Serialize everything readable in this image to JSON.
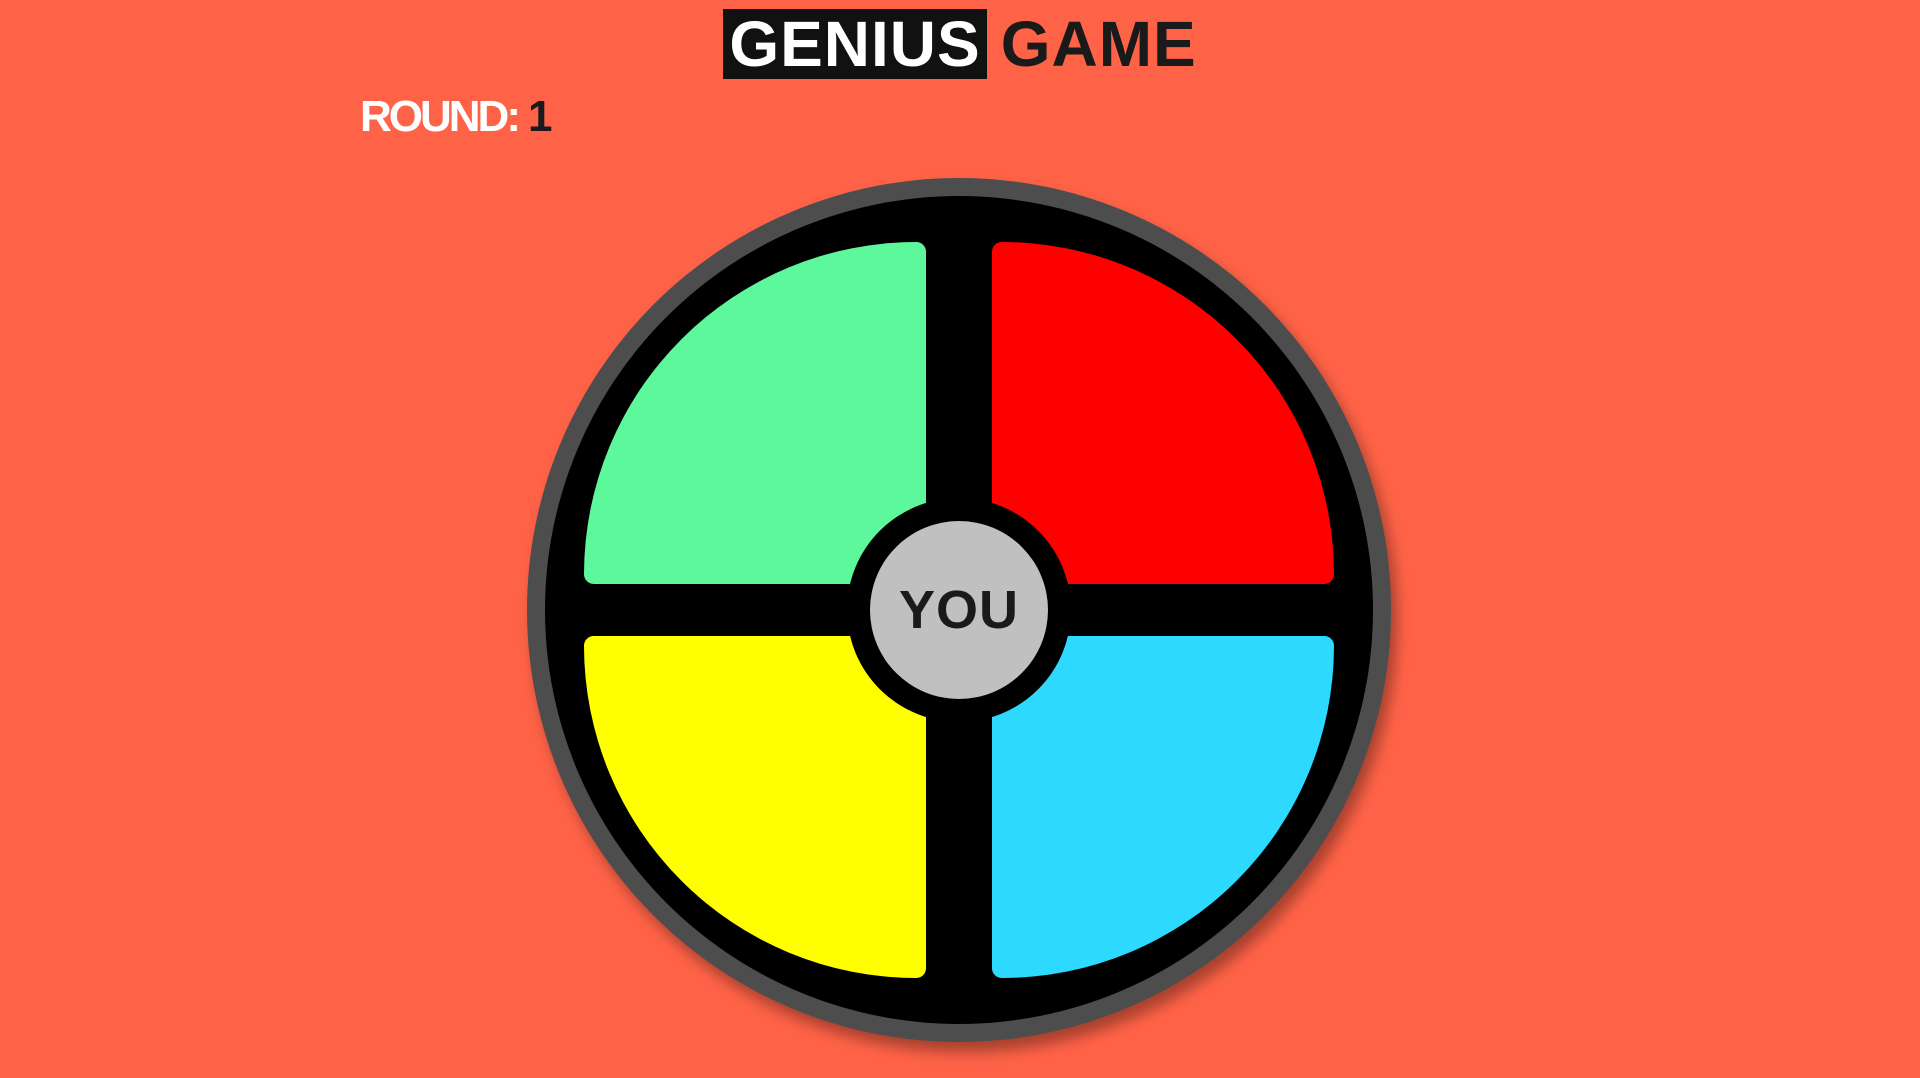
{
  "header": {
    "title_highlight": "GENIUS",
    "title_rest": "GAME"
  },
  "round": {
    "label": "ROUND:",
    "value": "1"
  },
  "board": {
    "center_label": "YOU",
    "pads": [
      {
        "position": "top-left",
        "color": "#5cf89b"
      },
      {
        "position": "top-right",
        "color": "#ff0000"
      },
      {
        "position": "bottom-left",
        "color": "#ffff00"
      },
      {
        "position": "bottom-right",
        "color": "#2ed9ff"
      }
    ]
  },
  "colors": {
    "background": "#ff6347",
    "rim": "#4d4d4d",
    "center": "#c0c0c0"
  }
}
